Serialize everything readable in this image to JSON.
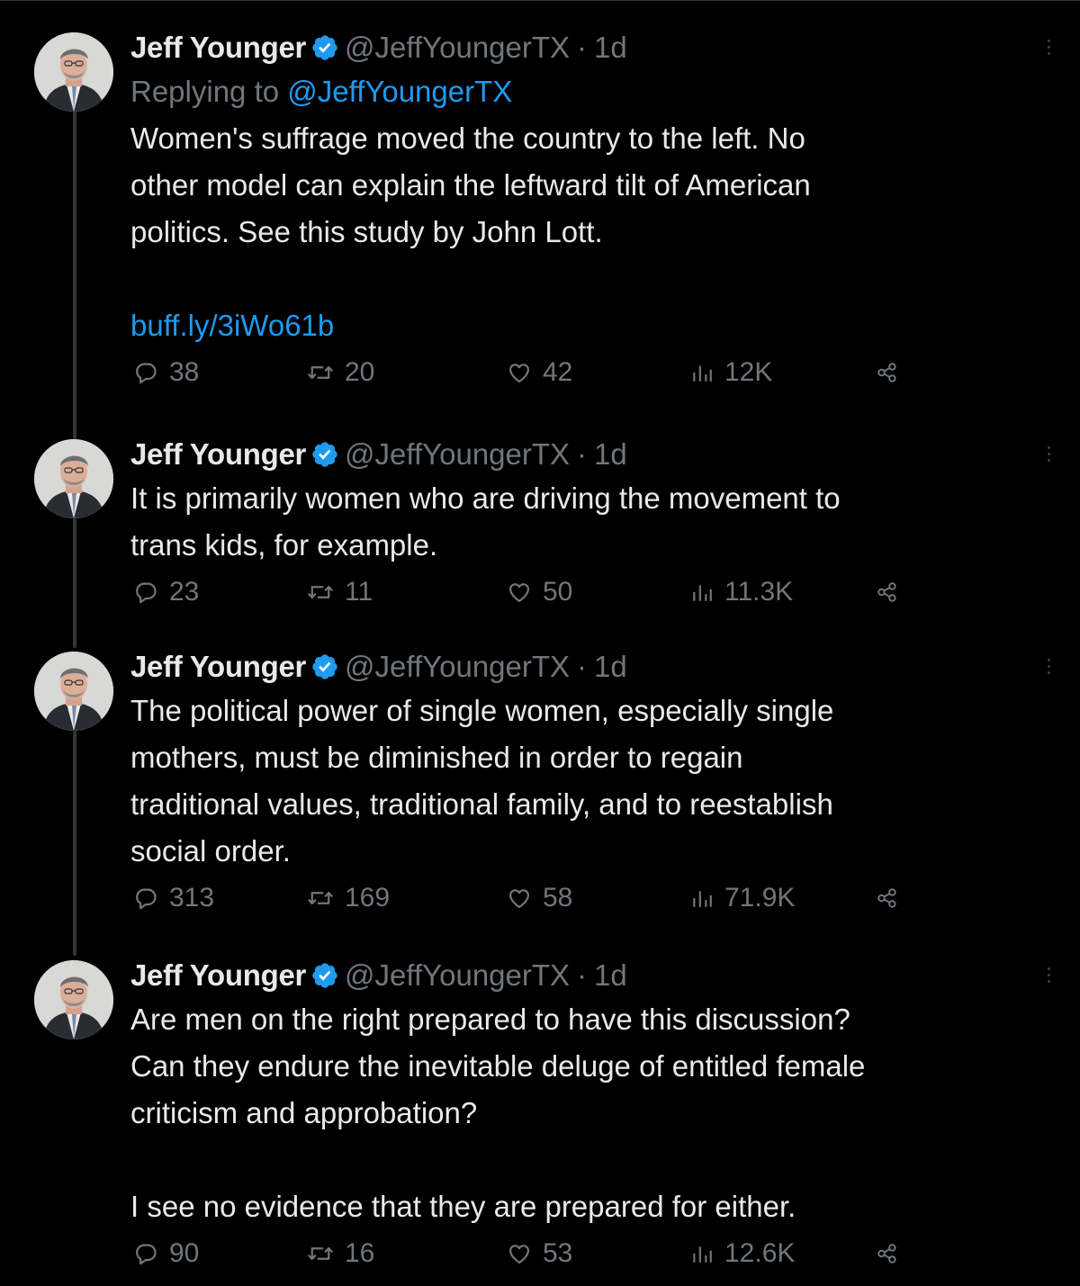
{
  "colors": {
    "background": "#000000",
    "text": "#e7e9ea",
    "muted": "#71767b",
    "link": "#1d9bf0",
    "verified": "#1d9bf0",
    "thread_line": "#333639"
  },
  "icons": {
    "reply": "speech-bubble-icon",
    "retweet": "retweet-arrows-icon",
    "like": "heart-icon",
    "views": "bar-chart-icon",
    "share": "share-nodes-icon",
    "more": "vertical-dots-icon",
    "verified": "verified-badge-icon"
  },
  "tweets": [
    {
      "author": "Jeff Younger",
      "handle": "@JeffYoungerTX",
      "separator": "·",
      "time": "1d",
      "replying_prefix": "Replying to",
      "replying_to": "@JeffYoungerTX",
      "lines": [
        "Women's suffrage moved the country to the left. No",
        "other model can explain the leftward tilt of American",
        "politics. See this study by John Lott."
      ],
      "link": "buff.ly/3iWo61b",
      "stats": {
        "replies": "38",
        "retweets": "20",
        "likes": "42",
        "views": "12K"
      }
    },
    {
      "author": "Jeff Younger",
      "handle": "@JeffYoungerTX",
      "separator": "·",
      "time": "1d",
      "lines": [
        "It is primarily women who are driving the movement to",
        "trans kids, for example."
      ],
      "stats": {
        "replies": "23",
        "retweets": "11",
        "likes": "50",
        "views": "11.3K"
      }
    },
    {
      "author": "Jeff Younger",
      "handle": "@JeffYoungerTX",
      "separator": "·",
      "time": "1d",
      "lines": [
        "The political power of single women, especially single",
        "mothers, must be diminished in order to regain",
        "traditional values, traditional family, and to reestablish",
        "social order."
      ],
      "stats": {
        "replies": "313",
        "retweets": "169",
        "likes": "58",
        "views": "71.9K"
      }
    },
    {
      "author": "Jeff Younger",
      "handle": "@JeffYoungerTX",
      "separator": "·",
      "time": "1d",
      "lines": [
        "Are men on the right prepared to have this discussion?",
        "Can they endure the inevitable deluge of entitled female",
        "criticism and approbation?"
      ],
      "lines_after_break": [
        "I see no evidence that they are prepared for either."
      ],
      "stats": {
        "replies": "90",
        "retweets": "16",
        "likes": "53",
        "views": "12.6K"
      }
    }
  ]
}
